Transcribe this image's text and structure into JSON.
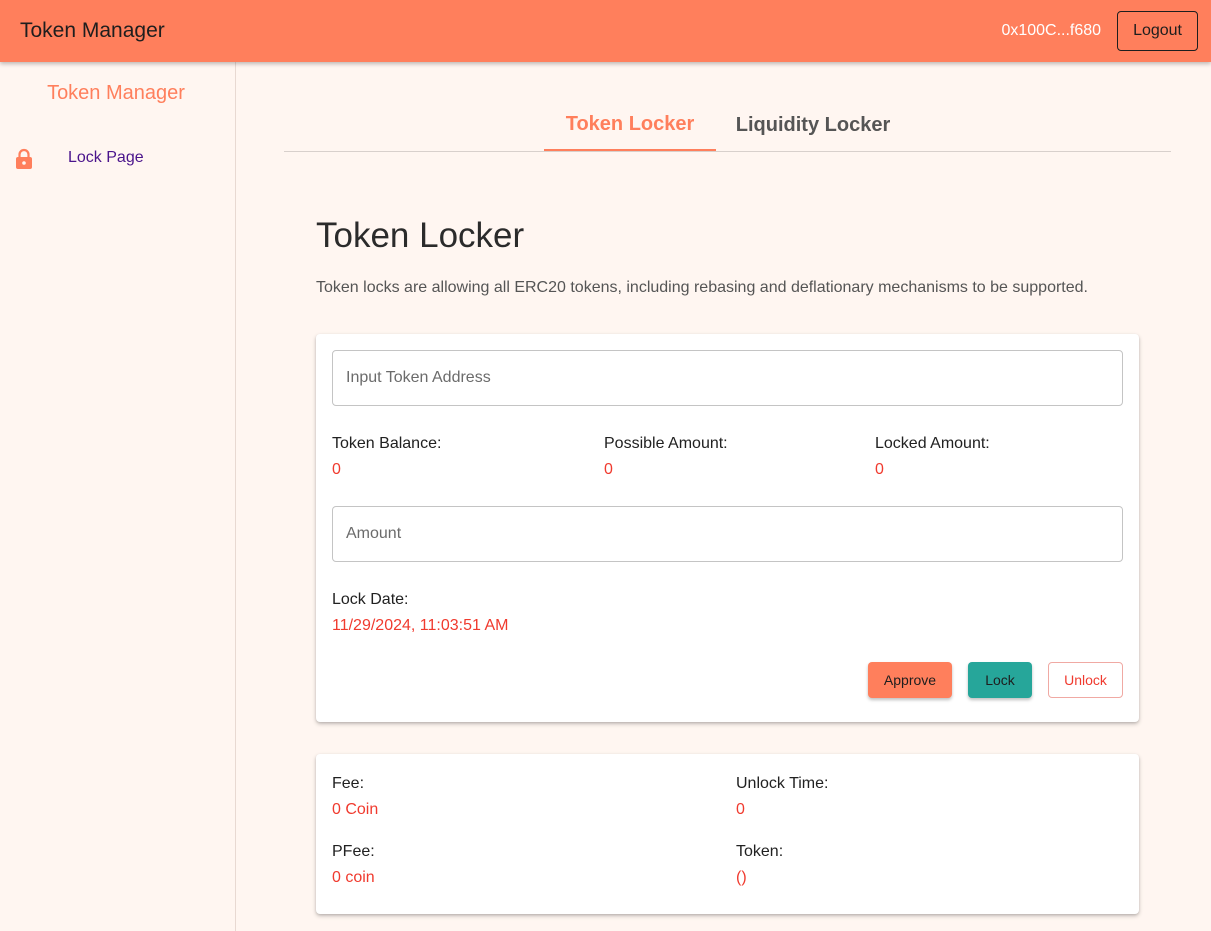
{
  "header": {
    "title": "Token Manager",
    "wallet_address": "0x100C...f680",
    "logout_label": "Logout",
    "bg_color": "#ff7f5c"
  },
  "sidebar": {
    "title": "Token Manager",
    "items": [
      {
        "label": "Lock Page",
        "icon": "lock-icon"
      }
    ]
  },
  "tabs": [
    {
      "label": "Token Locker",
      "active": true
    },
    {
      "label": "Liquidity Locker",
      "active": false
    }
  ],
  "main": {
    "heading": "Token Locker",
    "description": "Token locks are allowing all ERC20 tokens, including rebasing and deflationary mechanisms to be supported.",
    "token_input": {
      "placeholder": "Input Token Address",
      "value": ""
    },
    "stats": [
      {
        "label": "Token Balance:",
        "value": "0"
      },
      {
        "label": "Possible Amount:",
        "value": "0"
      },
      {
        "label": "Locked Amount:",
        "value": "0"
      }
    ],
    "amount_input": {
      "placeholder": "Amount",
      "value": ""
    },
    "lock_date": {
      "label": "Lock Date:",
      "value": "11/29/2024, 11:03:51 AM"
    },
    "buttons": {
      "approve": "Approve",
      "lock": "Lock",
      "unlock": "Unlock"
    }
  },
  "fees": {
    "fee": {
      "label": "Fee:",
      "value": "0 Coin"
    },
    "unlock_time": {
      "label": "Unlock Time:",
      "value": "0"
    },
    "pfee": {
      "label": "PFee:",
      "value": "0 coin"
    },
    "token": {
      "label": "Token:",
      "value": "()"
    }
  },
  "colors": {
    "accent": "#ff7f5c",
    "value_red": "#f03a2e",
    "lock_teal": "#26a69a",
    "nav_purple": "#4a148c"
  }
}
